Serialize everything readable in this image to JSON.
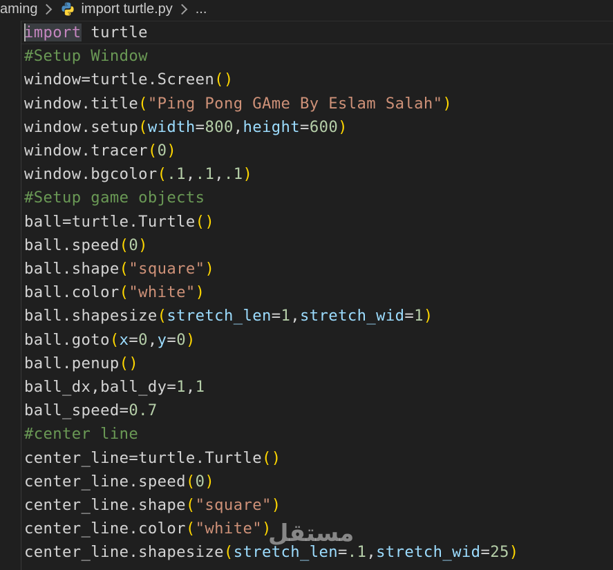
{
  "breadcrumb": {
    "folder": "aming",
    "file": "import turtle.py",
    "more": "..."
  },
  "icons": {
    "file_icon": "python-icon",
    "separator_icon": "chevron-right-icon"
  },
  "colors": {
    "background": "#1f1f1f",
    "keyword": "#c586c0",
    "comment": "#6a9955",
    "string": "#ce9178",
    "number": "#b5cea8",
    "parameter": "#9cdcfe",
    "bracket": "#ffd700",
    "default": "#d4d4d4"
  },
  "code": [
    [
      {
        "t": "import",
        "c": "keyword",
        "sel": true
      },
      {
        "t": " turtle",
        "c": "plain"
      }
    ],
    [
      {
        "t": "#Setup Window",
        "c": "comment"
      }
    ],
    [
      {
        "t": "window=turtle.Screen",
        "c": "plain"
      },
      {
        "t": "()",
        "c": "paren"
      }
    ],
    [
      {
        "t": "window.title",
        "c": "plain"
      },
      {
        "t": "(",
        "c": "paren"
      },
      {
        "t": "\"Ping Pong GAme By Eslam Salah\"",
        "c": "string"
      },
      {
        "t": ")",
        "c": "paren"
      }
    ],
    [
      {
        "t": "window.setup",
        "c": "plain"
      },
      {
        "t": "(",
        "c": "paren"
      },
      {
        "t": "width",
        "c": "param"
      },
      {
        "t": "=",
        "c": "plain"
      },
      {
        "t": "800",
        "c": "number"
      },
      {
        "t": ",",
        "c": "plain"
      },
      {
        "t": "height",
        "c": "param"
      },
      {
        "t": "=",
        "c": "plain"
      },
      {
        "t": "600",
        "c": "number"
      },
      {
        "t": ")",
        "c": "paren"
      }
    ],
    [
      {
        "t": "window.tracer",
        "c": "plain"
      },
      {
        "t": "(",
        "c": "paren"
      },
      {
        "t": "0",
        "c": "number"
      },
      {
        "t": ")",
        "c": "paren"
      }
    ],
    [
      {
        "t": "window.bgcolor",
        "c": "plain"
      },
      {
        "t": "(",
        "c": "paren"
      },
      {
        "t": ".1",
        "c": "number"
      },
      {
        "t": ",",
        "c": "plain"
      },
      {
        "t": ".1",
        "c": "number"
      },
      {
        "t": ",",
        "c": "plain"
      },
      {
        "t": ".1",
        "c": "number"
      },
      {
        "t": ")",
        "c": "paren"
      }
    ],
    [
      {
        "t": "#Setup game objects",
        "c": "comment"
      }
    ],
    [
      {
        "t": "ball=turtle.Turtle",
        "c": "plain"
      },
      {
        "t": "()",
        "c": "paren"
      }
    ],
    [
      {
        "t": "ball.speed",
        "c": "plain"
      },
      {
        "t": "(",
        "c": "paren"
      },
      {
        "t": "0",
        "c": "number"
      },
      {
        "t": ")",
        "c": "paren"
      }
    ],
    [
      {
        "t": "ball.shape",
        "c": "plain"
      },
      {
        "t": "(",
        "c": "paren"
      },
      {
        "t": "\"square\"",
        "c": "string"
      },
      {
        "t": ")",
        "c": "paren"
      }
    ],
    [
      {
        "t": "ball.color",
        "c": "plain"
      },
      {
        "t": "(",
        "c": "paren"
      },
      {
        "t": "\"white\"",
        "c": "string"
      },
      {
        "t": ")",
        "c": "paren"
      }
    ],
    [
      {
        "t": "ball.shapesize",
        "c": "plain"
      },
      {
        "t": "(",
        "c": "paren"
      },
      {
        "t": "stretch_len",
        "c": "param"
      },
      {
        "t": "=",
        "c": "plain"
      },
      {
        "t": "1",
        "c": "number"
      },
      {
        "t": ",",
        "c": "plain"
      },
      {
        "t": "stretch_wid",
        "c": "param"
      },
      {
        "t": "=",
        "c": "plain"
      },
      {
        "t": "1",
        "c": "number"
      },
      {
        "t": ")",
        "c": "paren"
      }
    ],
    [
      {
        "t": "ball.goto",
        "c": "plain"
      },
      {
        "t": "(",
        "c": "paren"
      },
      {
        "t": "x",
        "c": "param"
      },
      {
        "t": "=",
        "c": "plain"
      },
      {
        "t": "0",
        "c": "number"
      },
      {
        "t": ",",
        "c": "plain"
      },
      {
        "t": "y",
        "c": "param"
      },
      {
        "t": "=",
        "c": "plain"
      },
      {
        "t": "0",
        "c": "number"
      },
      {
        "t": ")",
        "c": "paren"
      }
    ],
    [
      {
        "t": "ball.penup",
        "c": "plain"
      },
      {
        "t": "()",
        "c": "paren"
      }
    ],
    [
      {
        "t": "ball_dx,ball_dy=",
        "c": "plain"
      },
      {
        "t": "1",
        "c": "number"
      },
      {
        "t": ",",
        "c": "plain"
      },
      {
        "t": "1",
        "c": "number"
      }
    ],
    [
      {
        "t": "ball_speed=",
        "c": "plain"
      },
      {
        "t": "0.7",
        "c": "number"
      }
    ],
    [
      {
        "t": "#center line",
        "c": "comment"
      }
    ],
    [
      {
        "t": "center_line=turtle.Turtle",
        "c": "plain"
      },
      {
        "t": "()",
        "c": "paren"
      }
    ],
    [
      {
        "t": "center_line.speed",
        "c": "plain"
      },
      {
        "t": "(",
        "c": "paren"
      },
      {
        "t": "0",
        "c": "number"
      },
      {
        "t": ")",
        "c": "paren"
      }
    ],
    [
      {
        "t": "center_line.shape",
        "c": "plain"
      },
      {
        "t": "(",
        "c": "paren"
      },
      {
        "t": "\"square\"",
        "c": "string"
      },
      {
        "t": ")",
        "c": "paren"
      }
    ],
    [
      {
        "t": "center_line.color",
        "c": "plain"
      },
      {
        "t": "(",
        "c": "paren"
      },
      {
        "t": "\"white\"",
        "c": "string"
      },
      {
        "t": ")",
        "c": "paren"
      }
    ],
    [
      {
        "t": "center_line.shapesize",
        "c": "plain"
      },
      {
        "t": "(",
        "c": "paren"
      },
      {
        "t": "stretch_len",
        "c": "param"
      },
      {
        "t": "=",
        "c": "plain"
      },
      {
        "t": ".1",
        "c": "number"
      },
      {
        "t": ",",
        "c": "plain"
      },
      {
        "t": "stretch_wid",
        "c": "param"
      },
      {
        "t": "=",
        "c": "plain"
      },
      {
        "t": "25",
        "c": "number"
      },
      {
        "t": ")",
        "c": "paren"
      }
    ]
  ],
  "watermark": "مستقل"
}
